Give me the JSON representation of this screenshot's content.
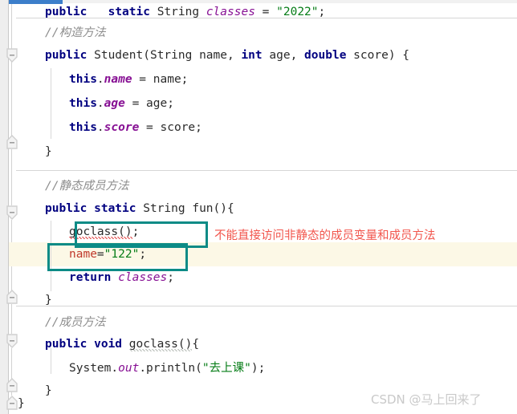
{
  "app": {
    "kind": "code-editor",
    "language": "java",
    "colors": {
      "keyword": "#000080",
      "string": "#067d17",
      "field": "#871094",
      "comment": "#8c8c8c",
      "error_text": "#c0392b",
      "annotation_box": "#0c8b86",
      "annotation_text": "#f2564d",
      "highlight_band": "#fcf8e6",
      "gutter": "#eeeeee",
      "scroll_thumb": "#3c7eca"
    }
  },
  "gutter": {
    "fold_icons": [
      {
        "name": "fold-collapse-down-1",
        "state": "expanded-down"
      },
      {
        "name": "fold-collapse-up-1",
        "state": "expanded-up"
      },
      {
        "name": "fold-collapse-down-2",
        "state": "expanded-down"
      },
      {
        "name": "fold-collapse-up-2",
        "state": "expanded-up"
      },
      {
        "name": "fold-collapse-down-3",
        "state": "expanded-down"
      },
      {
        "name": "fold-collapse-up-3",
        "state": "expanded-up"
      },
      {
        "name": "fold-collapse-up-4",
        "state": "expanded-up"
      }
    ]
  },
  "code": {
    "lines": [
      {
        "id": "line-field-classes",
        "text": "public   static String classes = \"2022\";",
        "tokens": [
          {
            "t": "public",
            "c": "kw"
          },
          {
            "t": "   ",
            "c": "pln"
          },
          {
            "t": "static",
            "c": "kw"
          },
          {
            "t": " String ",
            "c": "pln"
          },
          {
            "t": "classes",
            "c": "fld"
          },
          {
            "t": " = ",
            "c": "pln"
          },
          {
            "t": "\"2022\"",
            "c": "str"
          },
          {
            "t": ";",
            "c": "pln"
          }
        ]
      },
      {
        "id": "line-comment-constructor",
        "text": "//构造方法",
        "tokens": [
          {
            "t": "//构造方法",
            "c": "cmt"
          }
        ]
      },
      {
        "id": "line-constructor-signature",
        "text": "public Student(String name, int age, double score) {",
        "tokens": [
          {
            "t": "public",
            "c": "kw"
          },
          {
            "t": " Student(String name, ",
            "c": "pln"
          },
          {
            "t": "int",
            "c": "kw"
          },
          {
            "t": " age, ",
            "c": "pln"
          },
          {
            "t": "double",
            "c": "kw"
          },
          {
            "t": " score) {",
            "c": "pln"
          }
        ]
      },
      {
        "id": "line-this-name",
        "text": "this.name = name;",
        "tokens": [
          {
            "t": "this",
            "c": "kw"
          },
          {
            "t": ".",
            "c": "pln"
          },
          {
            "t": "name",
            "c": "sfld"
          },
          {
            "t": " = name;",
            "c": "pln"
          }
        ]
      },
      {
        "id": "line-this-age",
        "text": "this.age = age;",
        "tokens": [
          {
            "t": "this",
            "c": "kw"
          },
          {
            "t": ".",
            "c": "pln"
          },
          {
            "t": "age",
            "c": "sfld"
          },
          {
            "t": " = age;",
            "c": "pln"
          }
        ]
      },
      {
        "id": "line-this-score",
        "text": "this.score = score;",
        "tokens": [
          {
            "t": "this",
            "c": "kw"
          },
          {
            "t": ".",
            "c": "pln"
          },
          {
            "t": "score",
            "c": "sfld"
          },
          {
            "t": " = score;",
            "c": "pln"
          }
        ]
      },
      {
        "id": "line-constructor-close",
        "text": "}",
        "tokens": [
          {
            "t": "}",
            "c": "pln"
          }
        ]
      },
      {
        "id": "line-comment-static-method",
        "text": "//静态成员方法",
        "tokens": [
          {
            "t": "//静态成员方法",
            "c": "cmt"
          }
        ]
      },
      {
        "id": "line-fun-signature",
        "text": "public static String fun(){",
        "tokens": [
          {
            "t": "public static",
            "c": "kw"
          },
          {
            "t": " String fun(){",
            "c": "pln"
          }
        ]
      },
      {
        "id": "line-call-goclass",
        "text": "goclass();",
        "tokens": [
          {
            "t": "goclass()",
            "c": "pln sq-red"
          },
          {
            "t": ";",
            "c": "pln"
          }
        ]
      },
      {
        "id": "line-assign-name",
        "text": "name=\"122\";",
        "tokens": [
          {
            "t": "name",
            "c": "red"
          },
          {
            "t": "=",
            "c": "pln"
          },
          {
            "t": "\"122\"",
            "c": "str"
          },
          {
            "t": ";",
            "c": "pln"
          }
        ]
      },
      {
        "id": "line-return-classes",
        "text": "return classes;",
        "tokens": [
          {
            "t": "return",
            "c": "kw"
          },
          {
            "t": " ",
            "c": "pln"
          },
          {
            "t": "classes",
            "c": "fld"
          },
          {
            "t": ";",
            "c": "pln"
          }
        ]
      },
      {
        "id": "line-fun-close",
        "text": "}",
        "tokens": [
          {
            "t": "}",
            "c": "pln"
          }
        ]
      },
      {
        "id": "line-comment-member-method",
        "text": "//成员方法",
        "tokens": [
          {
            "t": "//成员方法",
            "c": "cmt"
          }
        ]
      },
      {
        "id": "line-goclass-signature",
        "text": "public void goclass(){",
        "tokens": [
          {
            "t": "public void",
            "c": "kw"
          },
          {
            "t": " ",
            "c": "pln"
          },
          {
            "t": "goclass()",
            "c": "pln sq-gry"
          },
          {
            "t": "{",
            "c": "pln"
          }
        ]
      },
      {
        "id": "line-println",
        "text": "System.out.println(\"去上课\");",
        "tokens": [
          {
            "t": "System.",
            "c": "pln"
          },
          {
            "t": "out",
            "c": "fld"
          },
          {
            "t": ".println(",
            "c": "pln"
          },
          {
            "t": "\"去上课\"",
            "c": "str"
          },
          {
            "t": ");",
            "c": "pln"
          }
        ]
      },
      {
        "id": "line-goclass-close",
        "text": "}",
        "tokens": [
          {
            "t": "}",
            "c": "pln"
          }
        ]
      },
      {
        "id": "line-class-close",
        "text": "}",
        "tokens": [
          {
            "t": "}",
            "c": "pln"
          }
        ]
      }
    ]
  },
  "annotations": {
    "boxes": [
      {
        "name": "highlight-box-goclass-call",
        "target": "goclass();"
      },
      {
        "name": "highlight-box-name-assign",
        "target": "name=\"122\";"
      }
    ],
    "note": "不能直接访问非静态的成员变量和成员方法"
  },
  "watermark": {
    "text": "CSDN @马上回来了"
  }
}
